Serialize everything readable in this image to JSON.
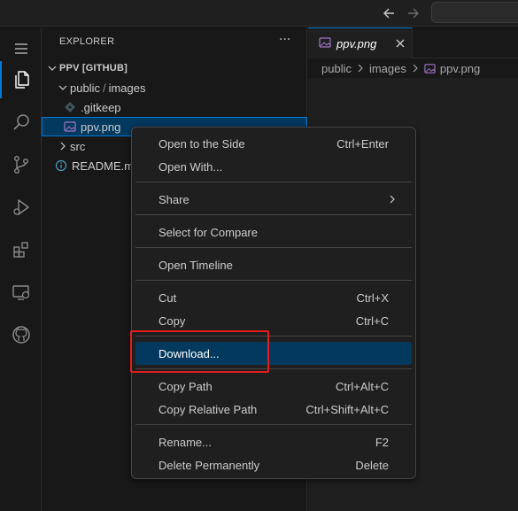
{
  "titlebar": {
    "back_icon": "arrow-left-icon",
    "forward_icon": "arrow-right-icon"
  },
  "activity_bar": [
    {
      "icon": "files-icon",
      "active": true
    },
    {
      "icon": "search-icon"
    },
    {
      "icon": "source-control-icon"
    },
    {
      "icon": "run-debug-icon"
    },
    {
      "icon": "extensions-icon"
    },
    {
      "icon": "remote-explorer-icon"
    },
    {
      "icon": "github-icon"
    }
  ],
  "sidebar": {
    "title": "EXPLORER",
    "more": "···",
    "root": "PPV [GITHUB]",
    "folder_public": "public",
    "folder_images": "images",
    "file_gitkeep": ".gitkeep",
    "file_ppv": "ppv.png",
    "folder_src": "src",
    "file_readme": "README.m"
  },
  "editor": {
    "tab_label": "ppv.png",
    "breadcrumbs": [
      "public",
      "images",
      "ppv.png"
    ]
  },
  "context_menu": {
    "open_side": "Open to the Side",
    "open_side_key": "Ctrl+Enter",
    "open_with": "Open With...",
    "share": "Share",
    "select_compare": "Select for Compare",
    "open_timeline": "Open Timeline",
    "cut": "Cut",
    "cut_key": "Ctrl+X",
    "copy": "Copy",
    "copy_key": "Ctrl+C",
    "download": "Download...",
    "copy_path": "Copy Path",
    "copy_path_key": "Ctrl+Alt+C",
    "copy_rel_path": "Copy Relative Path",
    "copy_rel_path_key": "Ctrl+Shift+Alt+C",
    "rename": "Rename...",
    "rename_key": "F2",
    "delete": "Delete Permanently",
    "delete_key": "Delete"
  },
  "colors": {
    "accent": "#0078d4",
    "selection": "#04395e",
    "annotation": "#e01e1e"
  }
}
